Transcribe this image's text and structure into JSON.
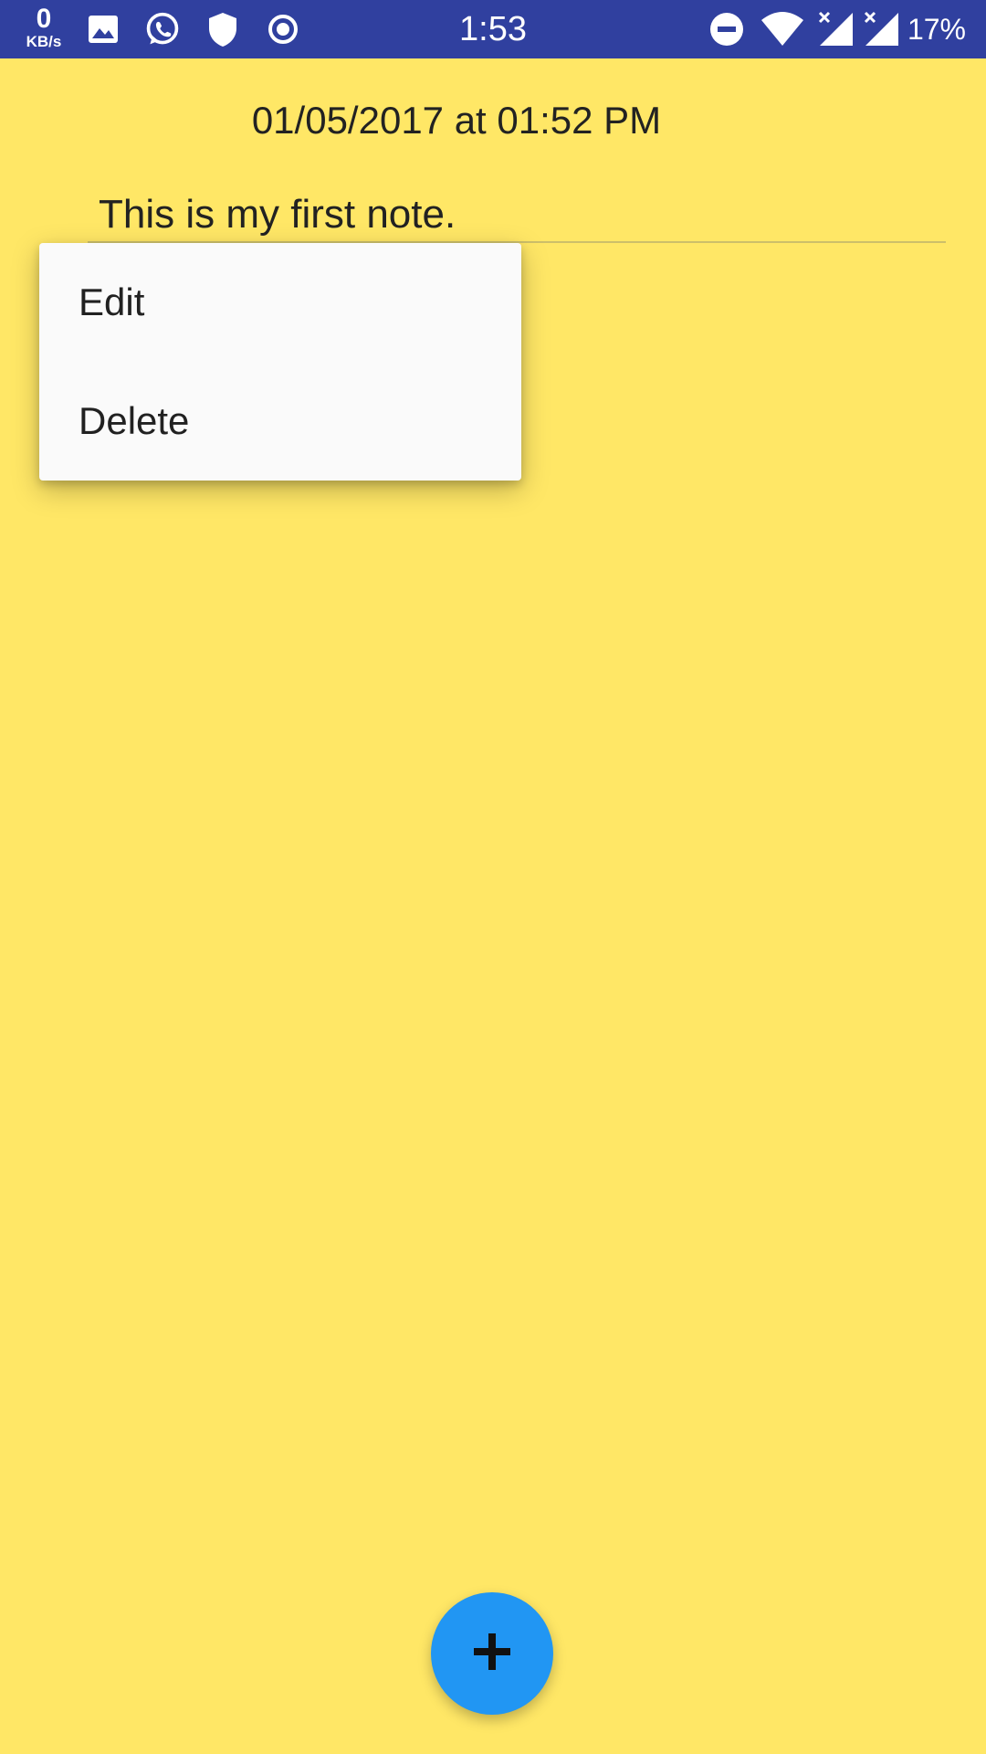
{
  "status_bar": {
    "network_speed_value": "0",
    "network_speed_unit": "KB/s",
    "time": "1:53",
    "battery": "17%",
    "background_color": "#30409F",
    "left_icons": [
      "gallery-icon",
      "whatsapp-icon",
      "shield-icon",
      "record-icon"
    ],
    "right_icons": [
      "do-not-disturb-icon",
      "wifi-icon",
      "signal-no-service-icon",
      "signal-no-service-icon"
    ]
  },
  "note": {
    "date": "01/05/2017 at 01:52 PM",
    "text": "This is my first note."
  },
  "context_menu": {
    "items": [
      {
        "label": "Edit"
      },
      {
        "label": "Delete"
      }
    ]
  },
  "fab": {
    "icon": "plus-icon",
    "color": "#2196F3"
  },
  "colors": {
    "background": "#FFE766",
    "menu_background": "#FAFAFA"
  }
}
